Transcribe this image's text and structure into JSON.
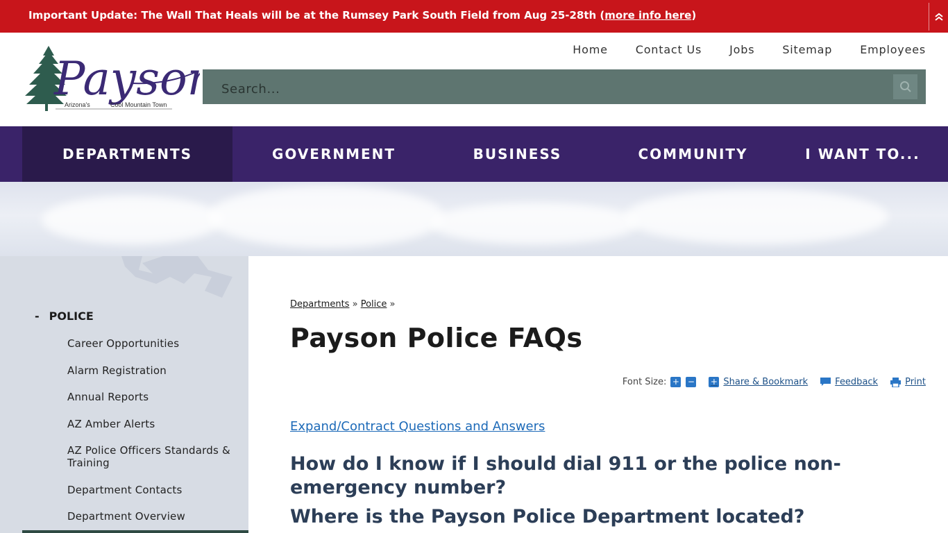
{
  "alert": {
    "text": "Important Update: The Wall That Heals will be at the Rumsey Park South Field from Aug 25-28th (",
    "link": "more info here",
    "close_paren": ")",
    "collapse_icon": "double-chevron-up-icon"
  },
  "logo": {
    "name": "Payson",
    "tagline_left": "Arizona's",
    "tagline_right": "Cool Mountain Town"
  },
  "utility_nav": [
    "Home",
    "Contact Us",
    "Jobs",
    "Sitemap",
    "Employees"
  ],
  "search": {
    "placeholder": "Search...",
    "icon": "search-icon"
  },
  "main_nav": [
    "DEPARTMENTS",
    "GOVERNMENT",
    "BUSINESS",
    "COMMUNITY",
    "I WANT TO..."
  ],
  "sidebar": {
    "toggle": "-",
    "heading": "POLICE",
    "items": [
      "Career Opportunities",
      "Alarm Registration",
      "Annual Reports",
      "AZ Amber Alerts",
      "AZ Police Officers Standards & Training",
      "Department Contacts",
      "Department Overview"
    ]
  },
  "breadcrumb": [
    "Departments",
    "Police"
  ],
  "breadcrumb_sep": "»",
  "page": {
    "title": "Payson Police FAQs",
    "font_size_label": "Font Size:",
    "font_increase": "+",
    "font_decrease": "−",
    "share_label": "Share & Bookmark",
    "feedback_label": "Feedback",
    "print_label": "Print",
    "expand_label": "Expand/Contract Questions and Answers",
    "questions": [
      "How do I know if I should dial 911 or the police non-emergency number?",
      "Where is the Payson Police Department located?"
    ]
  },
  "colors": {
    "alert": "#c8151b",
    "nav": "#3a2369",
    "nav_active": "#2a1a4b",
    "search": "#5e7570",
    "link": "#1d6ab8",
    "question": "#2c3e57"
  }
}
